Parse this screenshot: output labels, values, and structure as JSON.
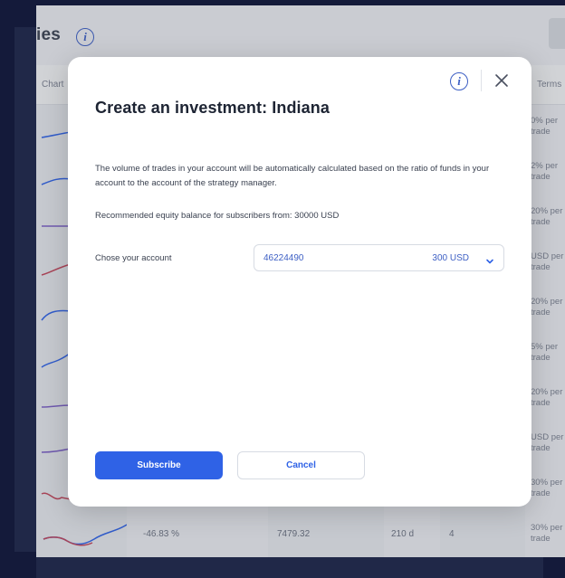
{
  "background": {
    "page_title_fragment": "ies",
    "columns": {
      "chart": "Chart",
      "terms": "Terms"
    },
    "rows": [
      {
        "terms": "0% per trade",
        "spark_color": "#2f62e6"
      },
      {
        "terms": "2% per trade",
        "spark_color": "#2f62e6"
      },
      {
        "terms": "20% per trade",
        "spark_color": "#7a5fc4"
      },
      {
        "terms": "USD per trade",
        "spark_color": "#c0455a"
      },
      {
        "terms": "20% per trade",
        "spark_color": "#2f62e6"
      },
      {
        "terms": "5% per trade",
        "spark_color": "#2f62e6"
      },
      {
        "terms": "20% per trade",
        "spark_color": "#7a5fc4"
      },
      {
        "terms": "USD per trade",
        "spark_color": "#7a5fc4"
      },
      {
        "terms": "30% per trade",
        "spark_color": "#c0455a"
      }
    ],
    "last_row": {
      "profit": "-46.83 %",
      "equity": "7479.32",
      "age": "210 d",
      "count": "4",
      "terms": "30% per trade"
    }
  },
  "modal": {
    "title": "Create an investment: Indiana",
    "info_icon_glyph": "i",
    "description": "The volume of trades in your account will be automatically calculated based on the ratio of funds in your account to the account of the strategy manager.",
    "recommended": "Recommended equity balance for subscribers from: 30000 USD",
    "account_label": "Chose your account",
    "account_number": "46224490",
    "account_balance": "300 USD",
    "subscribe_label": "Subscribe",
    "cancel_label": "Cancel"
  },
  "colors": {
    "accent": "#2f62e6",
    "link": "#3d5fc4",
    "text": "#1d2433",
    "backdrop": "#0b1236"
  },
  "icons": {
    "info": "info-icon",
    "close": "close-icon",
    "dropdown": "chevron-down-icon"
  }
}
